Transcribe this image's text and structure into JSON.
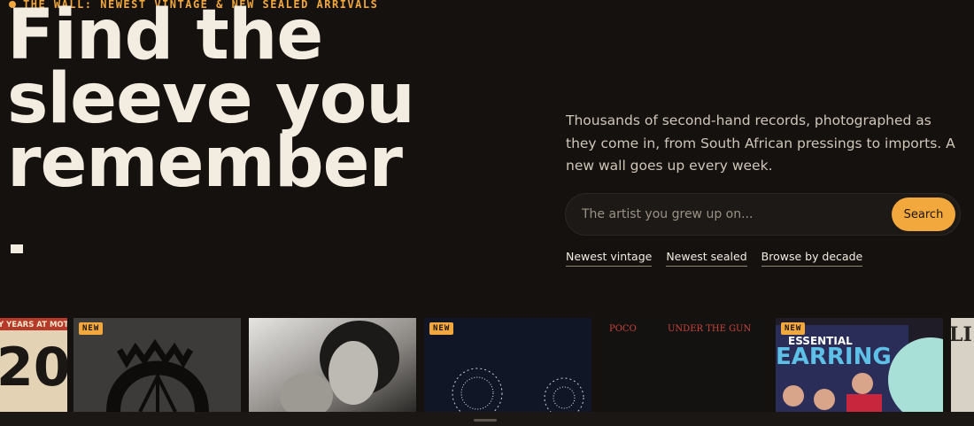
{
  "eyebrow": {
    "text": "THE WALL: NEWEST VINTAGE & NEW SEALED ARRIVALS"
  },
  "hero": {
    "line1": "Find the",
    "line2": "sleeve you",
    "line3": "remember",
    "lede": "Thousands of second-hand records, photographed as they come in, from South African pressings to imports. A new wall goes up every week."
  },
  "search": {
    "placeholder": "The artist you grew up on...",
    "button": "Search"
  },
  "links": [
    "Newest vintage",
    "Newest sealed",
    "Browse by decade"
  ],
  "records": {
    "card0": {
      "top_text": "Y YEARS AT MOTOWN",
      "number": "20"
    },
    "card1": {
      "badge": "NEW"
    },
    "card2": {},
    "card3": {
      "badge": "NEW"
    },
    "card4": {
      "left_text": "POCO",
      "right_text": "UNDER THE GUN"
    },
    "card5": {
      "badge": "NEW",
      "line1": "ESSENTIAL",
      "line2": "EARRING"
    },
    "card6": {
      "fragment": "LI"
    }
  },
  "colors": {
    "accent": "#f2a83c",
    "background": "#15110f",
    "text": "#f3ece0"
  }
}
